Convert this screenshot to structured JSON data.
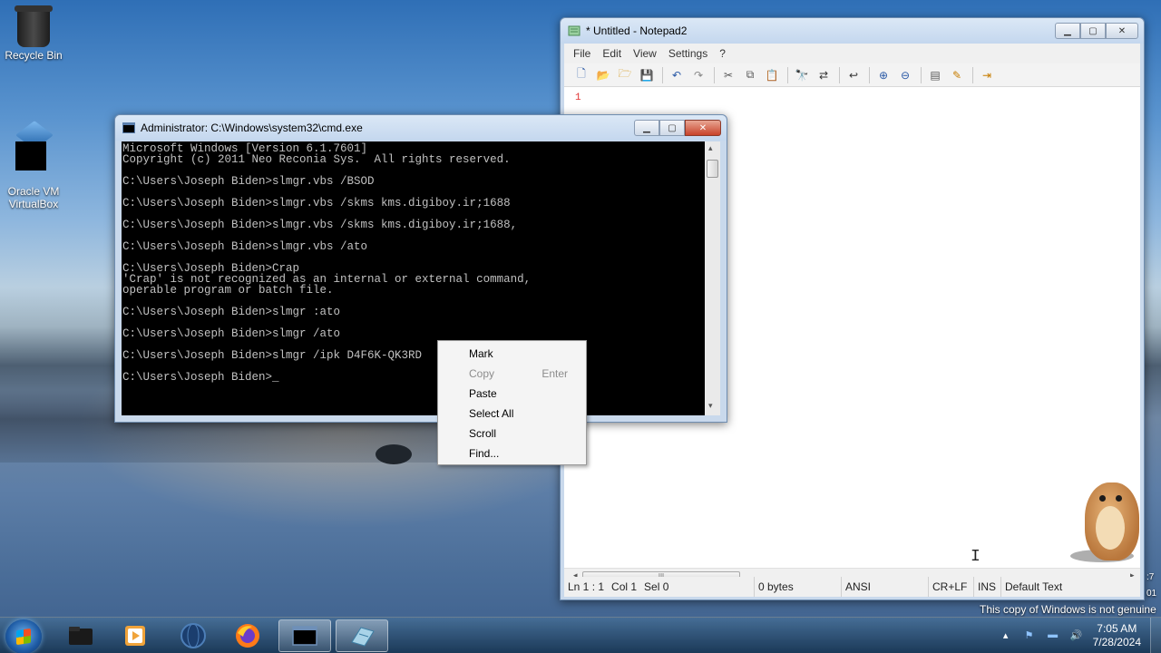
{
  "desktop": {
    "icons": [
      {
        "label": "Recycle Bin"
      },
      {
        "label": "Oracle VM\nVirtualBox"
      }
    ],
    "watermark": "This copy of Windows is not genuine",
    "edge_fragments": [
      ":7",
      "01"
    ]
  },
  "notepad": {
    "title": "* Untitled - Notepad2",
    "menu": [
      "File",
      "Edit",
      "View",
      "Settings",
      "?"
    ],
    "line_number": "1",
    "status": {
      "position": "Ln 1 : 1",
      "col": "Col 1",
      "sel": "Sel 0",
      "size": "0 bytes",
      "encoding": "ANSI",
      "eol": "CR+LF",
      "mode": "INS",
      "scheme": "Default Text"
    }
  },
  "cmd": {
    "title": "Administrator: C:\\Windows\\system32\\cmd.exe",
    "lines": "Microsoft Windows [Version 6.1.7601]\nCopyright (c) 2011 Neo Reconia Sys.  All rights reserved.\n\nC:\\Users\\Joseph Biden>slmgr.vbs /BSOD\n\nC:\\Users\\Joseph Biden>slmgr.vbs /skms kms.digiboy.ir;1688\n\nC:\\Users\\Joseph Biden>slmgr.vbs /skms kms.digiboy.ir;1688,\n\nC:\\Users\\Joseph Biden>slmgr.vbs /ato\n\nC:\\Users\\Joseph Biden>Crap\n'Crap' is not recognized as an internal or external command,\noperable program or batch file.\n\nC:\\Users\\Joseph Biden>slmgr :ato\n\nC:\\Users\\Joseph Biden>slmgr /ato\n\nC:\\Users\\Joseph Biden>slmgr /ipk D4F6K-QK3RD\n\nC:\\Users\\Joseph Biden>_"
  },
  "context_menu": {
    "items": [
      {
        "label": "Mark",
        "accel": ""
      },
      {
        "label": "Copy",
        "accel": "Enter"
      },
      {
        "label": "Paste",
        "accel": ""
      },
      {
        "label": "Select All",
        "accel": ""
      },
      {
        "label": "Scroll",
        "accel": ""
      },
      {
        "label": "Find...",
        "accel": ""
      }
    ]
  },
  "taskbar": {
    "clock_time": "7:05 AM",
    "clock_date": "7/28/2024"
  },
  "colors": {
    "line_number": "#e03030",
    "console_bg": "#000000",
    "console_fg": "#c0c0c0",
    "close_button": "#c8432a"
  }
}
